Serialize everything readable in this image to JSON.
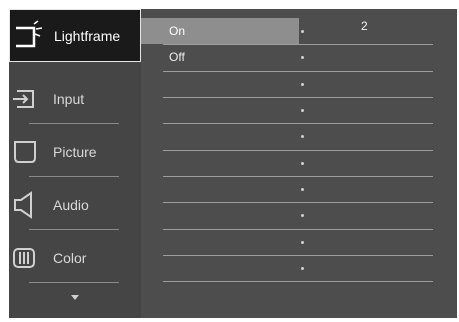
{
  "menu": {
    "items": [
      {
        "label": "Lightframe",
        "icon": "lightframe-icon",
        "selected": true
      },
      {
        "label": "Input",
        "icon": "input-icon",
        "selected": false
      },
      {
        "label": "Picture",
        "icon": "picture-icon",
        "selected": false
      },
      {
        "label": "Audio",
        "icon": "audio-icon",
        "selected": false
      },
      {
        "label": "Color",
        "icon": "color-icon",
        "selected": false
      }
    ],
    "more_icon": "chevron-down-icon"
  },
  "submenu": {
    "options": [
      {
        "label": "On",
        "highlighted": true
      },
      {
        "label": "Off",
        "highlighted": false
      }
    ],
    "value": "2"
  },
  "colors": {
    "menu_bg": "#454545",
    "panel_bg": "#4d4d4d",
    "highlight": "#8e8e8e",
    "selected_bg": "#1a1a1a"
  }
}
